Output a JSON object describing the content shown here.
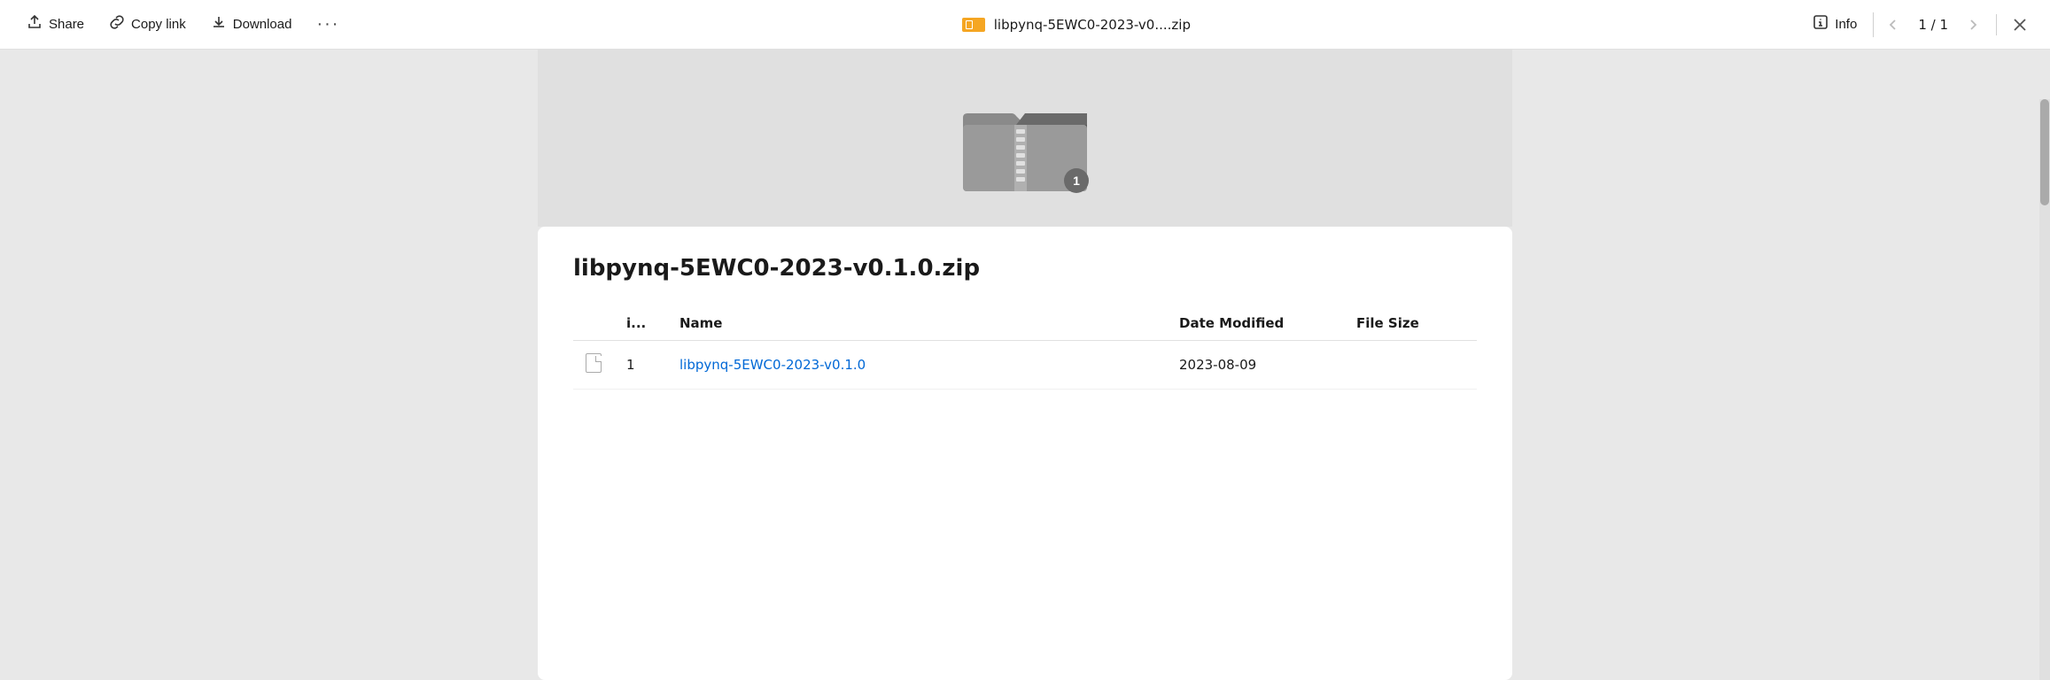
{
  "toolbar": {
    "share_label": "Share",
    "copy_link_label": "Copy link",
    "download_label": "Download",
    "more_label": "···",
    "file_badge_color": "#f5a623",
    "file_title": "libpynq-5EWC0-2023-v0....zip",
    "info_label": "Info",
    "page_current": "1",
    "page_total": "1",
    "page_indicator": "1 / 1"
  },
  "preview": {
    "zip_badge_count": "1"
  },
  "file_card": {
    "file_name": "libpynq-5EWC0-2023-v0.1.0.zip",
    "table": {
      "col_index": "i...",
      "col_name": "Name",
      "col_date": "Date Modified",
      "col_size": "File Size",
      "rows": [
        {
          "name": "libpynq-5EWC0-2023-v0.1.0",
          "date": "2023-08-09",
          "size": ""
        }
      ]
    }
  }
}
